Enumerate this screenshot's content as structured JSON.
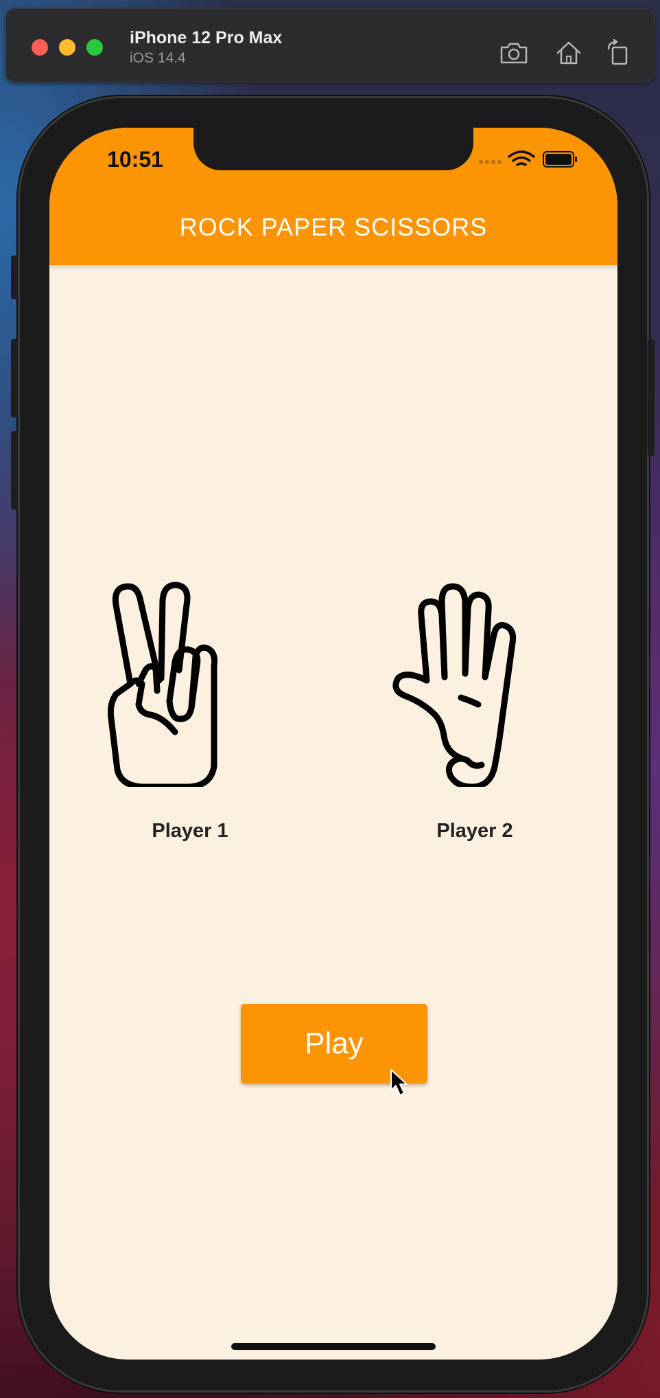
{
  "simulator": {
    "device_name": "iPhone 12 Pro Max",
    "os_version": "iOS 14.4",
    "toolbar": {
      "screenshot_icon": "camera-icon",
      "home_icon": "home-icon",
      "rotate_icon": "rotate-icon"
    },
    "traffic_lights": [
      "#fe5f57",
      "#febc2e",
      "#28c840"
    ]
  },
  "status_bar": {
    "time": "10:51",
    "icons": [
      "signal-dots-icon",
      "wifi-icon",
      "battery-icon"
    ]
  },
  "app_bar": {
    "title": "ROCK PAPER SCISSORS"
  },
  "players": [
    {
      "label": "Player 1",
      "hand_icon": "scissors-hand-icon"
    },
    {
      "label": "Player 2",
      "hand_icon": "paper-hand-icon"
    }
  ],
  "play_button": {
    "label": "Play"
  },
  "colors": {
    "accent": "#fd9404",
    "background": "#fcf0e0"
  }
}
